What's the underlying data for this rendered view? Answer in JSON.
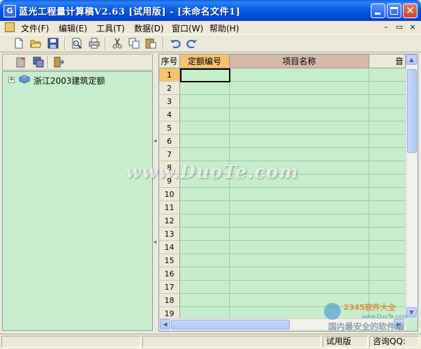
{
  "window": {
    "title": "蓝光工程量计算稿V2.63 [试用版] - [未命名文件1]",
    "app_icon_letter": "G"
  },
  "menu": {
    "items": [
      "文件(F)",
      "编辑(E)",
      "工具(T)",
      "数据(D)",
      "窗口(W)",
      "帮助(H)"
    ],
    "mdi_controls": [
      "–",
      "▭",
      "×"
    ]
  },
  "toolbar": {
    "tools": [
      "new-file-icon",
      "open-folder-icon",
      "save-disk-icon",
      "print-preview-icon",
      "print-icon",
      "cut-icon",
      "copy-icon",
      "paste-icon",
      "undo-icon",
      "redo-icon"
    ]
  },
  "tree": {
    "root": {
      "label": "浙江2003建筑定额",
      "expand_symbol": "+"
    }
  },
  "grid": {
    "headers": [
      "序号",
      "定额编号",
      "项目名称",
      "音"
    ],
    "rows": [
      "1",
      "2",
      "3",
      "4",
      "5",
      "6",
      "7",
      "8",
      "9",
      "10",
      "11",
      "12",
      "13",
      "14",
      "15",
      "16",
      "17",
      "18",
      "19"
    ],
    "colors": {
      "background": "#C7EDCC",
      "header_highlight": "#F7C26B",
      "header_selected": "#D5B8A8"
    }
  },
  "status": {
    "edition": "试用版",
    "consult": "咨询QQ:"
  },
  "watermark": {
    "text": "www.DuoTe.com",
    "corner_text": "2345软件大全",
    "corner_url": "www.DuoTe.com",
    "corner_caption": "国内最安全的软件站"
  }
}
